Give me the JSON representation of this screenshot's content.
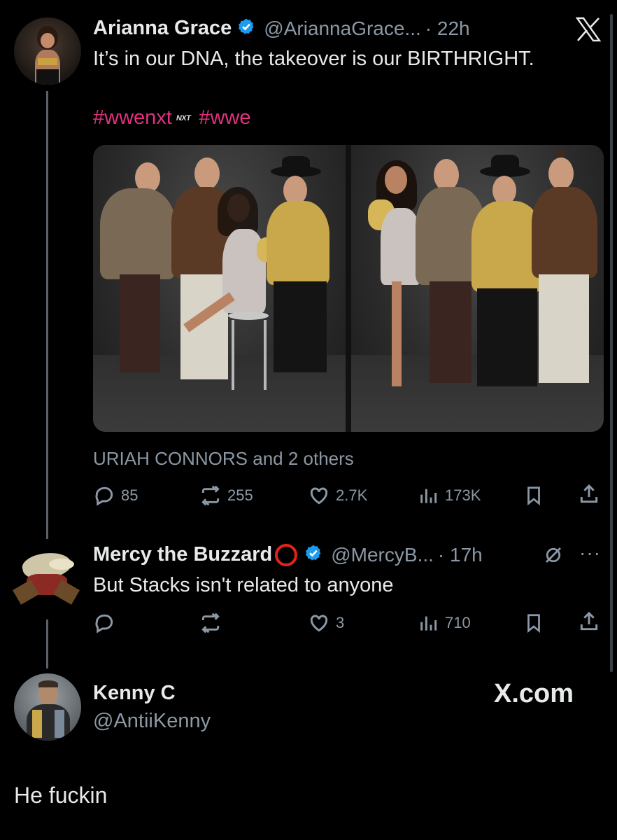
{
  "tweet1": {
    "name": "Arianna Grace",
    "handle": "@AriannaGrace...",
    "time": "· 22h",
    "text": "It’s in our DNA, the takeover is our BIRTHRIGHT.",
    "hashtags": [
      "#wwenxt",
      "#wwe"
    ],
    "nxt_emoji": "NXT",
    "tagged": "URIAH CONNORS and 2 others",
    "metrics": {
      "replies": "85",
      "reposts": "255",
      "likes": "2.7K",
      "views": "173K"
    }
  },
  "tweet2": {
    "name": "Mercy the Buzzard",
    "handle": "@MercyB...",
    "time": "· 17h",
    "text": "But Stacks isn't related to anyone",
    "metrics": {
      "replies": "",
      "reposts": "",
      "likes": "3",
      "views": "710"
    }
  },
  "quote_author": {
    "name": "Kenny C",
    "handle": "@AntiiKenny",
    "brand": "X.com"
  },
  "reply_text": "He fuckin",
  "colors": {
    "background": "#000000",
    "text": "#e7e9ea",
    "muted": "#8b98a5",
    "hashtag": "#e0317e",
    "verified": "#1d9bf0",
    "thread_line": "#5b6168"
  },
  "icons": [
    "x-logo-icon",
    "verified-badge-icon",
    "reply-icon",
    "repost-icon",
    "like-icon",
    "views-icon",
    "bookmark-icon",
    "share-icon",
    "grok-icon",
    "more-icon",
    "red-circle-icon"
  ]
}
